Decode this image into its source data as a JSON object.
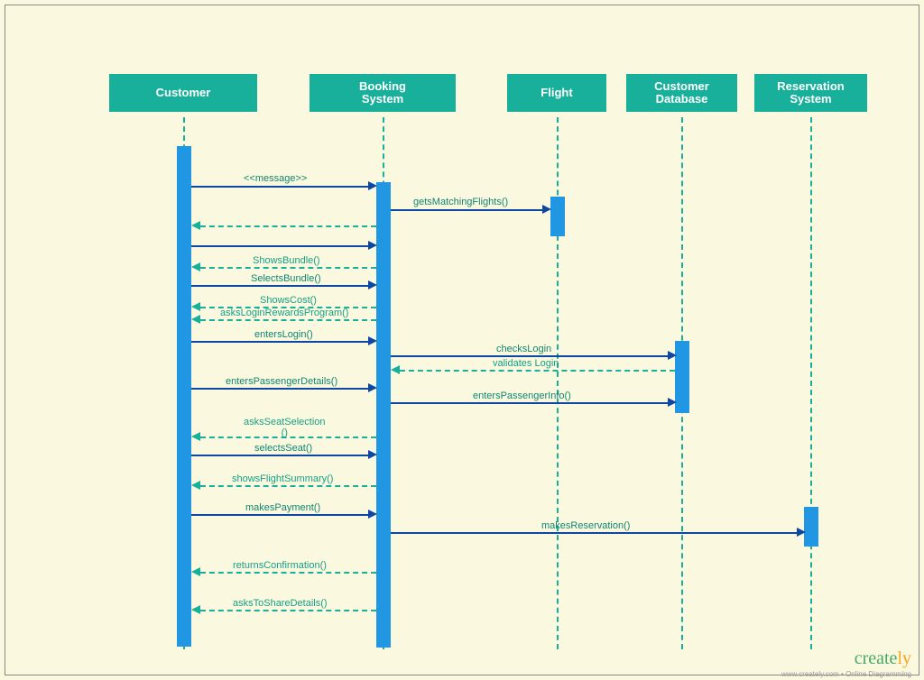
{
  "participants": {
    "customer": "Customer",
    "booking": "Booking\nSystem",
    "flight": "Flight",
    "custdb": "Customer\nDatabase",
    "reservation": "Reservation\nSystem"
  },
  "messages": {
    "m1": "<<message>>",
    "m2": "getsMatchingFlights()",
    "m3": "ShowsBundle()",
    "m4": "SelectsBundle()",
    "m5": "ShowsCost()",
    "m6": "asksLoginRewardsProgram()",
    "m7": "entersLogin()",
    "m8": "checksLogin",
    "m9": "validates Login",
    "m10": "entersPassengerDetails()",
    "m11": "entersPassengerInfo()",
    "m12": "asksSeatSelection\n()",
    "m13": "selectsSeat()",
    "m14": "showsFlightSummary()",
    "m15": "makesPayment()",
    "m16": "makesReservation()",
    "m17": "returnsConfirmation()",
    "m18": "asksToShareDetails()"
  },
  "logo": {
    "text": "create",
    "suffix": "ly",
    "tagline": "www.creately.com • Online Diagramming"
  }
}
